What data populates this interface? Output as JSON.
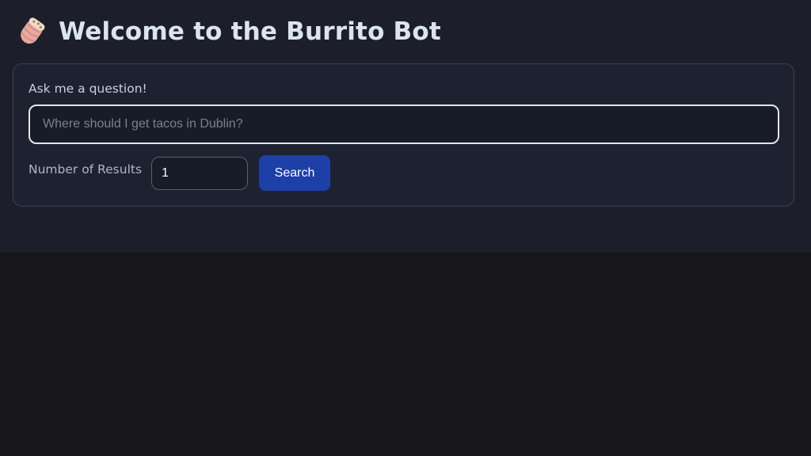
{
  "header": {
    "icon": "burrito-icon",
    "title": "Welcome to the Burrito Bot"
  },
  "form": {
    "question_label": "Ask me a question!",
    "question_placeholder": "Where should I get tacos in Dublin?",
    "question_value": "",
    "results_label": "Number of Results",
    "results_value": "1",
    "search_label": "Search"
  },
  "colors": {
    "page_background": "#18181b",
    "app_background": "#1c1f2b",
    "card_background": "#1e2230",
    "button_background": "#1d3fa8",
    "title_color": "#dbe4f0"
  }
}
